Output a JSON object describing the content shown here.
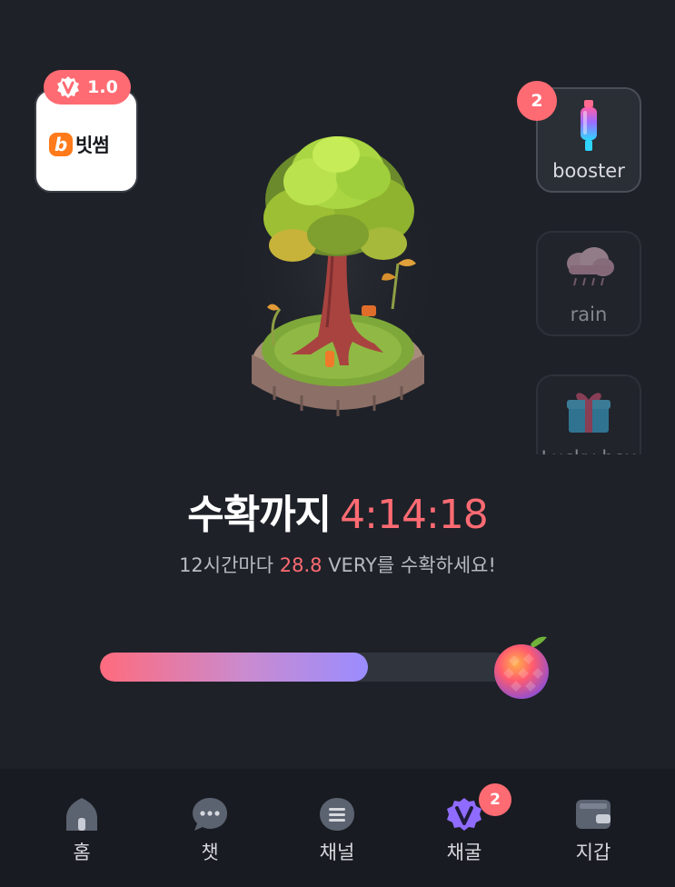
{
  "brand": {
    "logo_letter": "b",
    "name": "빗썸",
    "version": "1.0"
  },
  "side_items": [
    {
      "label": "booster",
      "badge": "2",
      "icon": "booster-bottle-icon"
    },
    {
      "label": "rain",
      "icon": "rain-cloud-icon"
    },
    {
      "label": "Lucky box",
      "icon": "gift-box-icon"
    }
  ],
  "harvest": {
    "title": "수확까지",
    "timer": "4:14:18",
    "sub_prefix": "12시간마다 ",
    "sub_amount": "28.8",
    "sub_suffix": " VERY를 수확하세요!"
  },
  "progress": {
    "fraction": 0.655
  },
  "nav": {
    "items": [
      {
        "label": "홈",
        "icon": "home-icon"
      },
      {
        "label": "챗",
        "icon": "chat-icon"
      },
      {
        "label": "채널",
        "icon": "channel-icon"
      },
      {
        "label": "채굴",
        "icon": "mining-v-icon",
        "badge": "2"
      },
      {
        "label": "지갑",
        "icon": "wallet-icon"
      }
    ]
  },
  "colors": {
    "background": "#1e2128",
    "accent": "#ff6b73",
    "purple": "#8f6bff",
    "nav_bg": "#181b21"
  }
}
